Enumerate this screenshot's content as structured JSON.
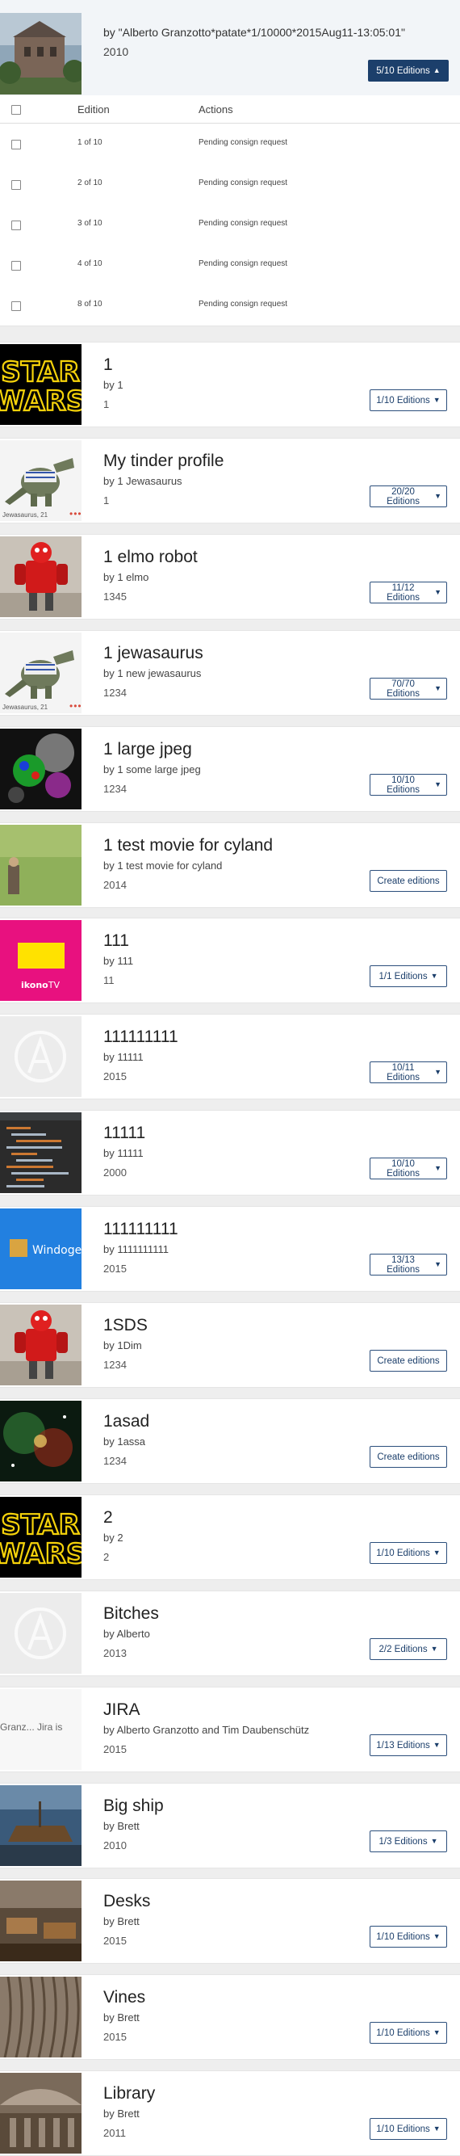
{
  "expanded": {
    "by": "by \"Alberto Granzotto*patate*1/10000*2015Aug11-13:05:01\"",
    "year": "2010",
    "editions_button": "5/10 Editions",
    "table": {
      "header_edition": "Edition",
      "header_actions": "Actions",
      "rows": [
        {
          "edition": "1 of 10",
          "action": "Pending consign request"
        },
        {
          "edition": "2 of 10",
          "action": "Pending consign request"
        },
        {
          "edition": "3 of 10",
          "action": "Pending consign request"
        },
        {
          "edition": "4 of 10",
          "action": "Pending consign request"
        },
        {
          "edition": "8 of 10",
          "action": "Pending consign request"
        }
      ]
    }
  },
  "pieces": [
    {
      "title": "1",
      "by": "by 1",
      "year": "1",
      "button": "1/10 Editions",
      "thumb": "starwars"
    },
    {
      "title": "My tinder profile",
      "by": "by 1 Jewasaurus",
      "year": "1",
      "button": "20/20 Editions",
      "thumb": "dino",
      "caption": "Jewasaurus, 21"
    },
    {
      "title": "1 elmo robot",
      "by": "by 1 elmo",
      "year": "1345",
      "button": "11/12 Editions",
      "thumb": "robot"
    },
    {
      "title": "1 jewasaurus",
      "by": "by 1 new jewasaurus",
      "year": "1234",
      "button": "70/70 Editions",
      "thumb": "dino",
      "caption": "Jewasaurus, 21"
    },
    {
      "title": "1 large jpeg",
      "by": "by 1 some large jpeg",
      "year": "1234",
      "button": "10/10 Editions",
      "thumb": "spheres"
    },
    {
      "title": "1 test movie for cyland",
      "by": "by 1 test movie for cyland",
      "year": "2014",
      "button": "Create editions",
      "thumb": "grass"
    },
    {
      "title": "111",
      "by": "by 111",
      "year": "11",
      "button": "1/1 Editions",
      "thumb": "ikono",
      "caption": "ikonoTV"
    },
    {
      "title": "111111111",
      "by": "by 11111",
      "year": "2015",
      "button": "10/11 Editions",
      "thumb": "placeholder"
    },
    {
      "title": "11111",
      "by": "by 11111",
      "year": "2000",
      "button": "10/10 Editions",
      "thumb": "code"
    },
    {
      "title": "111111111",
      "by": "by 1111111111",
      "year": "2015",
      "button": "13/13 Editions",
      "thumb": "windoge",
      "caption": "Windoge"
    },
    {
      "title": "1SDS",
      "by": "by 1Dim",
      "year": "1234",
      "button": "Create editions",
      "thumb": "robot"
    },
    {
      "title": "1asad",
      "by": "by 1assa",
      "year": "1234",
      "button": "Create editions",
      "thumb": "nebula"
    },
    {
      "title": "2",
      "by": "by 2",
      "year": "2",
      "button": "1/10 Editions",
      "thumb": "starwars"
    },
    {
      "title": "Bitches",
      "by": "by Alberto",
      "year": "2013",
      "button": "2/2 Editions",
      "thumb": "placeholder"
    },
    {
      "title": "JIRA",
      "by": "by Alberto Granzotto and Tim Daubenschütz",
      "year": "2015",
      "button": "1/13 Editions",
      "thumb": "jira",
      "caption": "Granz...   Jira is"
    },
    {
      "title": "Big ship",
      "by": "by Brett",
      "year": "2010",
      "button": "1/3 Editions",
      "thumb": "museum"
    },
    {
      "title": "Desks",
      "by": "by Brett",
      "year": "2015",
      "button": "1/10 Editions",
      "thumb": "desks"
    },
    {
      "title": "Vines",
      "by": "by Brett",
      "year": "2015",
      "button": "1/10 Editions",
      "thumb": "vines"
    },
    {
      "title": "Library",
      "by": "by Brett",
      "year": "2011",
      "button": "1/10 Editions",
      "thumb": "library"
    }
  ]
}
